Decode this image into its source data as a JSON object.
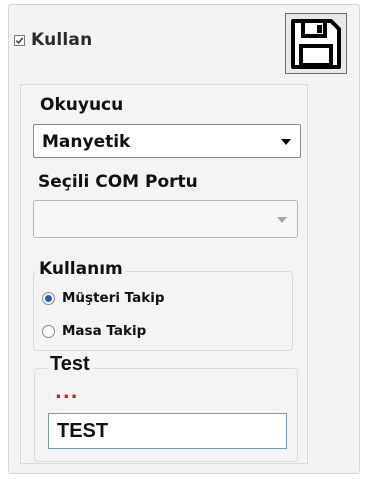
{
  "top": {
    "use_checkbox_checked": true,
    "use_label": "Kullan",
    "save_icon": "floppy-disk-icon"
  },
  "reader": {
    "label": "Okuyucu",
    "selected": "Manyetik"
  },
  "com_port": {
    "label": "Seçili COM Portu",
    "selected": ""
  },
  "usage": {
    "legend": "Kullanım",
    "options": [
      {
        "label": "Müşteri Takip",
        "selected": true
      },
      {
        "label": "Masa Takip",
        "selected": false
      }
    ]
  },
  "test": {
    "legend": "Test",
    "status_text": "...",
    "status_color": "#e01010",
    "input_value": "TEST"
  }
}
